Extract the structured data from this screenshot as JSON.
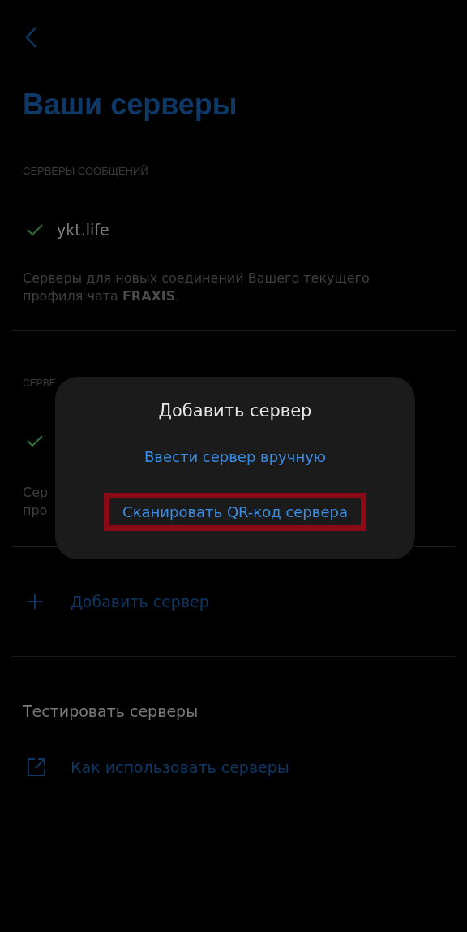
{
  "title": "Ваши серверы",
  "section": {
    "header": "СЕРВЕРЫ СООБЩЕНИЙ",
    "servers": [
      {
        "name": "ykt.life",
        "checked": true
      }
    ],
    "description": "Серверы для новых соединений Вашего текущего профиля чата **FRAXIS**."
  },
  "covered_section": {
    "header": "СЕРВЕ",
    "checked": true,
    "description_lines": [
      "Сер",
      "про"
    ]
  },
  "add_server": "Добавить сервер",
  "test_servers": "Тестировать серверы",
  "help_link": "Как использовать серверы",
  "dialog": {
    "title": "Добавить сервер",
    "options": [
      {
        "label": "Ввести сервер вручную",
        "highlighted": false
      },
      {
        "label": "Сканировать QR-код сервера",
        "highlighted": true
      }
    ]
  }
}
